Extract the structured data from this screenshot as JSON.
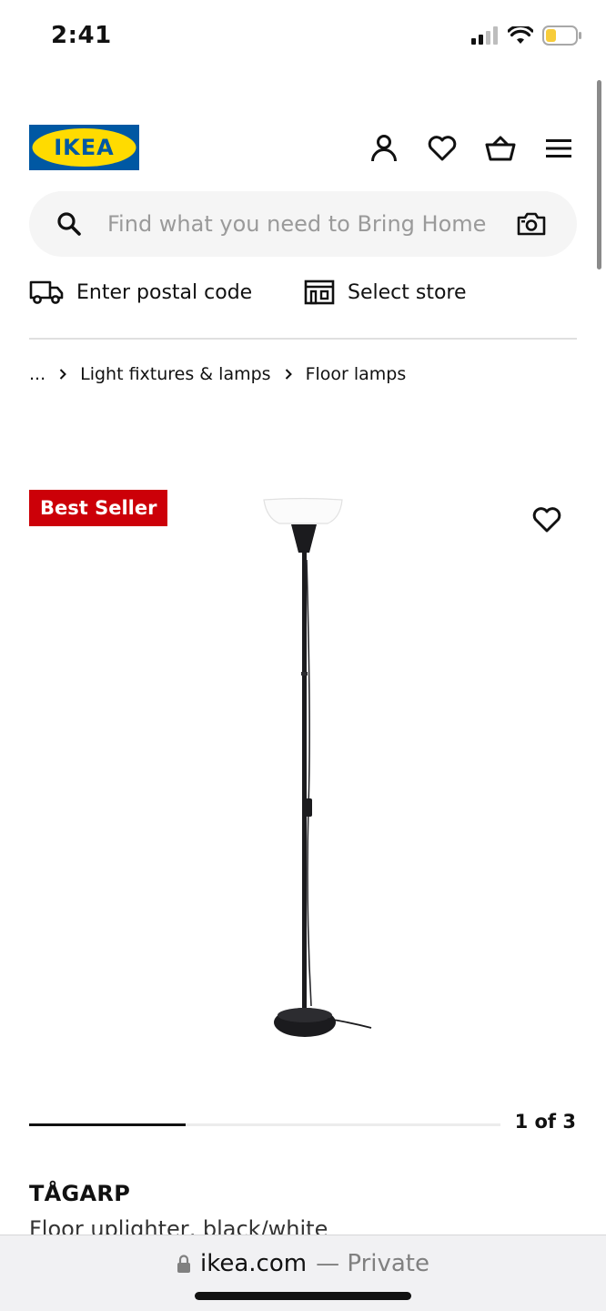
{
  "status_bar": {
    "time": "2:41"
  },
  "header": {
    "logo_text": "IKEA",
    "brand_colors": {
      "blue": "#0058a3",
      "yellow": "#ffdb00"
    },
    "icons": [
      "person-icon",
      "heart-icon",
      "basket-icon",
      "menu-icon"
    ]
  },
  "search": {
    "placeholder": "Find what you need to Bring Home",
    "value": ""
  },
  "delivery": {
    "postal_label": "Enter postal code",
    "store_label": "Select store"
  },
  "breadcrumb": {
    "ellipsis": "...",
    "items": [
      "Light fixtures & lamps",
      "Floor lamps"
    ]
  },
  "product": {
    "badge": "Best Seller",
    "badge_color": "#cc0008",
    "name": "TÅGARP",
    "description": "Floor uplighter, black/white"
  },
  "carousel": {
    "counter": "1 of 3",
    "progress": 0.333
  },
  "browser": {
    "domain": "ikea.com",
    "private_label": "— Private"
  }
}
